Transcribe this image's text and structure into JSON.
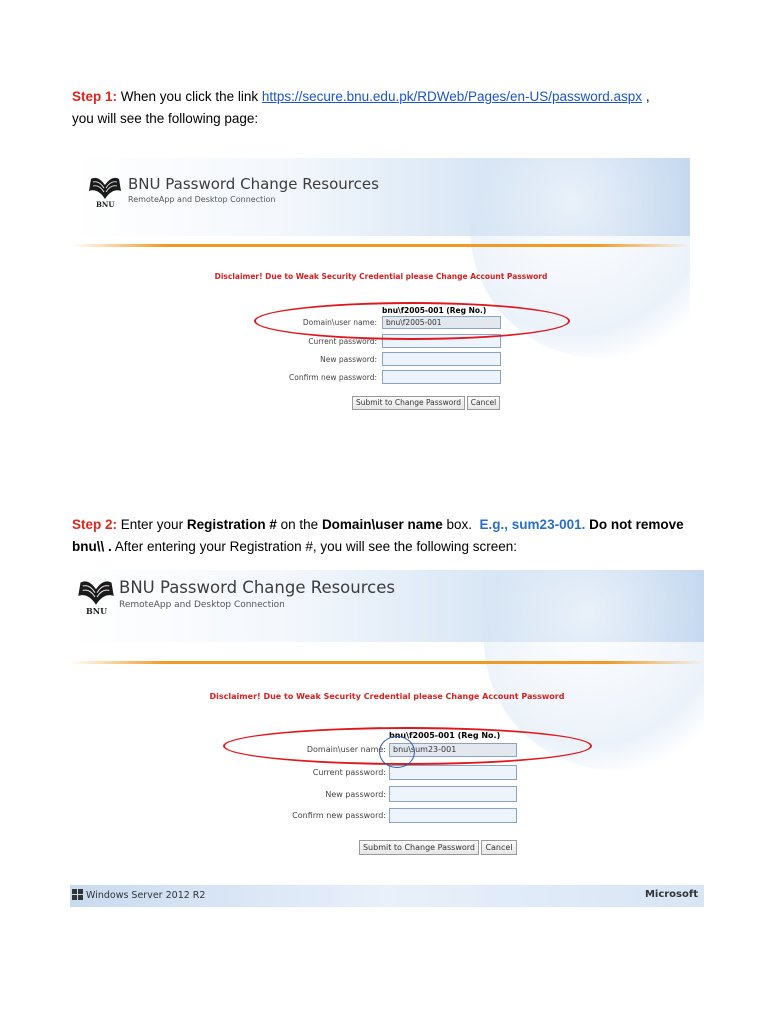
{
  "step1": {
    "label": "Step 1:",
    "text_before_link": "When you click the link",
    "link": "https://secure.bnu.edu.pk/RDWeb/Pages/en-US/password.aspx",
    "text_after_link": ",",
    "line2": "you will see the following page:"
  },
  "step2": {
    "label": "Step 2:",
    "t1": "Enter your",
    "b1": "Registration #",
    "t2": "on the",
    "b2": "Domain\\user name",
    "t3": "box.",
    "example": "E.g., sum23-001.",
    "b3": "Do not remove",
    "b4": "bnu\\\\ .",
    "t4": "After entering your Registration #, you will see the following screen:"
  },
  "shot1": {
    "logo_text": "BNU",
    "title": "BNU Password Change Resources",
    "subtitle": "RemoteApp and Desktop Connection",
    "disclaimer": "Disclaimer! Due to Weak Security Credential please Change Account Password",
    "reg_hint": "bnu\\f2005-001 (Reg No.)",
    "fields": [
      {
        "label": "Domain\\user name:",
        "value": "bnu\\f2005-001"
      },
      {
        "label": "Current password:",
        "value": ""
      },
      {
        "label": "New password:",
        "value": ""
      },
      {
        "label": "Confirm new password:",
        "value": ""
      }
    ],
    "submit_label": "Submit to Change Password",
    "cancel_label": "Cancel"
  },
  "shot2": {
    "logo_text": "BNU",
    "title": "BNU Password Change Resources",
    "subtitle": "RemoteApp and Desktop Connection",
    "disclaimer": "Disclaimer! Due to Weak Security Credential please Change Account Password",
    "reg_hint": "bnu\\f2005-001 (Reg No.)",
    "fields": [
      {
        "label": "Domain\\user name:",
        "value": "bnu\\sum23-001"
      },
      {
        "label": "Current password:",
        "value": ""
      },
      {
        "label": "New password:",
        "value": ""
      },
      {
        "label": "Confirm new password:",
        "value": ""
      }
    ],
    "submit_label": "Submit to Change Password",
    "cancel_label": "Cancel",
    "footer_os": "Windows Server 2012 R2",
    "footer_brand": "Microsoft"
  },
  "colors": {
    "step_label": "#e0261b",
    "link": "#1a56c8",
    "example": "#2a6fc4",
    "disclaimer": "#d42121",
    "highlight_ellipse": "#e0171d",
    "divider": "#f29a26"
  }
}
